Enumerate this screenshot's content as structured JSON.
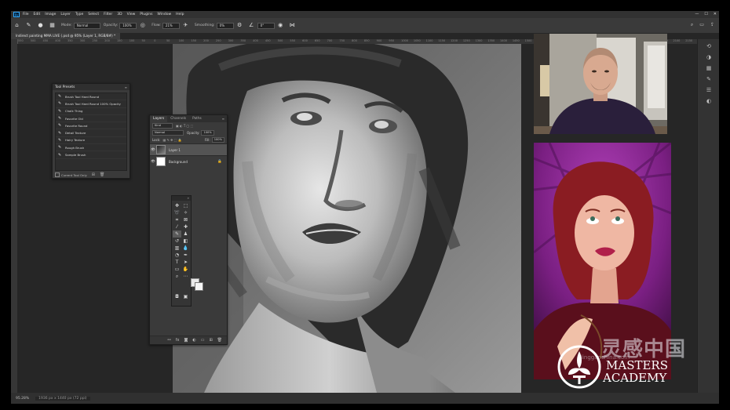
{
  "app": {
    "logo": "Ps",
    "menu": [
      "File",
      "Edit",
      "Image",
      "Layer",
      "Type",
      "Select",
      "Filter",
      "3D",
      "View",
      "Plugins",
      "Window",
      "Help"
    ],
    "window_controls": [
      "—",
      "☐",
      "✕"
    ]
  },
  "options_bar": {
    "mode_label": "Mode:",
    "mode_value": "Normal",
    "opacity_label": "Opacity:",
    "opacity_value": "100%",
    "flow_label": "Flow:",
    "flow_value": "21%",
    "smoothing_label": "Smoothing:",
    "smoothing_value": "0%",
    "angle_value": "0°"
  },
  "document_tab": {
    "title": "Indirect painting MMA LIVE (.psd @ 95% (Layer 1, RGB/8#) *"
  },
  "ruler_ticks": [
    "550",
    "500",
    "450",
    "400",
    "350",
    "300",
    "250",
    "200",
    "150",
    "100",
    "50",
    "0",
    "50",
    "100",
    "150",
    "200",
    "250",
    "300",
    "350",
    "400",
    "450",
    "500",
    "550",
    "600",
    "650",
    "700",
    "750",
    "800",
    "850",
    "900",
    "950",
    "1000",
    "1050",
    "1100",
    "1150",
    "1200",
    "1250",
    "1300",
    "1350",
    "1400",
    "1450",
    "1500",
    "1550",
    "1600",
    "1650",
    "1700",
    "1750",
    "1800",
    "1850",
    "1900",
    "1950",
    "2000",
    "2050",
    "2100",
    "2150"
  ],
  "status_bar": {
    "zoom": "95.28%",
    "doc_info": "1936 px x 1440 px (72 ppi)"
  },
  "tool_presets": {
    "title": "Tool Presets",
    "items": [
      "Brush Tool Hard Round",
      "Brush Tool Hard Round 100% Opacity",
      "Chalk Thing",
      "Favorite Old",
      "Favorite Round",
      "Detail Texture",
      "Hairy Texture",
      "Rough Brush",
      "Sample Brush"
    ],
    "current_tool_only": "Current Tool Only"
  },
  "layers_panel": {
    "tabs": [
      "Layers",
      "Channels",
      "Paths"
    ],
    "kind_label": "Kind",
    "blend_mode": "Normal",
    "opacity_label": "Opacity:",
    "opacity_value": "100%",
    "lock_label": "Lock:",
    "fill_label": "Fill:",
    "fill_value": "100%",
    "layers": [
      {
        "name": "Layer 1",
        "selected": true
      },
      {
        "name": "Background",
        "selected": false,
        "locked": true
      }
    ]
  },
  "watermark": {
    "cn": "灵感中国",
    "url": "lingganchina.com",
    "brand_line1": "MASTERS",
    "brand_line2": "ACADEMY"
  },
  "colors": {
    "foreground": "#eaeaea",
    "background": "#f5f5f5",
    "reference_bg": "#6d1a72"
  }
}
